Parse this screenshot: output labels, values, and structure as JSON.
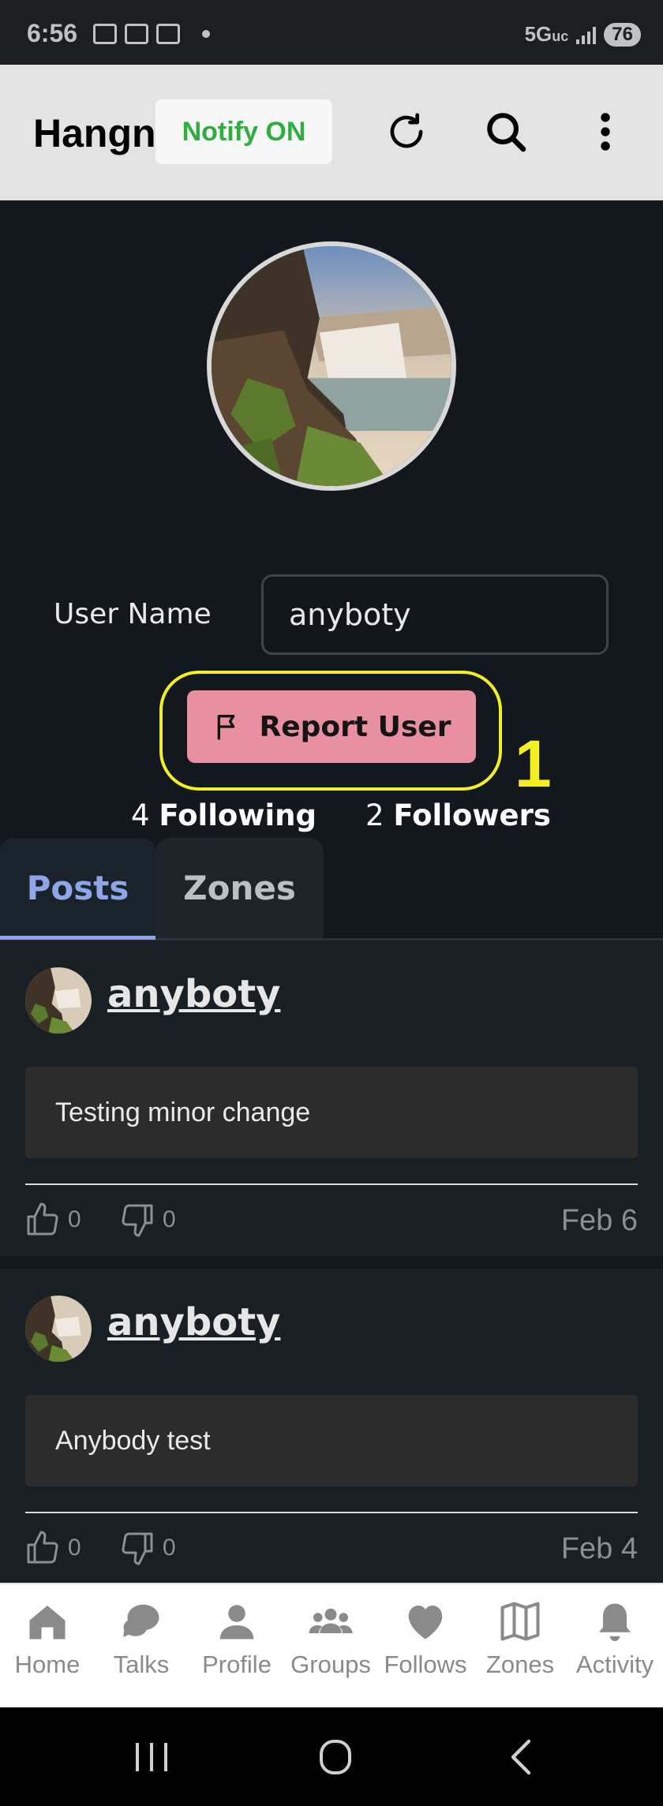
{
  "status_bar": {
    "time": "6:56",
    "network": "5G",
    "network_suffix": "uc",
    "battery": "76"
  },
  "header": {
    "title": "Hangn",
    "notify_label": "Notify ON",
    "icons": [
      "refresh-icon",
      "search-icon",
      "more-vert-icon"
    ]
  },
  "profile": {
    "username_label": "User Name",
    "username_value": "anyboty",
    "report_label": "Report User",
    "annotation": "1",
    "following_count": "4",
    "following_label": "Following",
    "followers_count": "2",
    "followers_label": "Followers"
  },
  "tabs": [
    {
      "label": "Posts",
      "active": true
    },
    {
      "label": "Zones",
      "active": false
    }
  ],
  "posts": [
    {
      "user": "anyboty",
      "text": "Testing minor change",
      "likes": "0",
      "dislikes": "0",
      "date": "Feb 6"
    },
    {
      "user": "anyboty",
      "text": "Anybody test",
      "likes": "0",
      "dislikes": "0",
      "date": "Feb 4"
    }
  ],
  "bottom_nav": [
    {
      "label": "Home",
      "icon": "home-icon"
    },
    {
      "label": "Talks",
      "icon": "chat-icon"
    },
    {
      "label": "Profile",
      "icon": "person-icon"
    },
    {
      "label": "Groups",
      "icon": "groups-icon"
    },
    {
      "label": "Follows",
      "icon": "heart-icon"
    },
    {
      "label": "Zones",
      "icon": "map-icon"
    },
    {
      "label": "Activity",
      "icon": "bell-icon"
    }
  ],
  "colors": {
    "accent_tab": "#8ea6e8",
    "report_button": "#e8909f",
    "notify_text": "#2fae3f",
    "annotation": "#f4ef22"
  }
}
